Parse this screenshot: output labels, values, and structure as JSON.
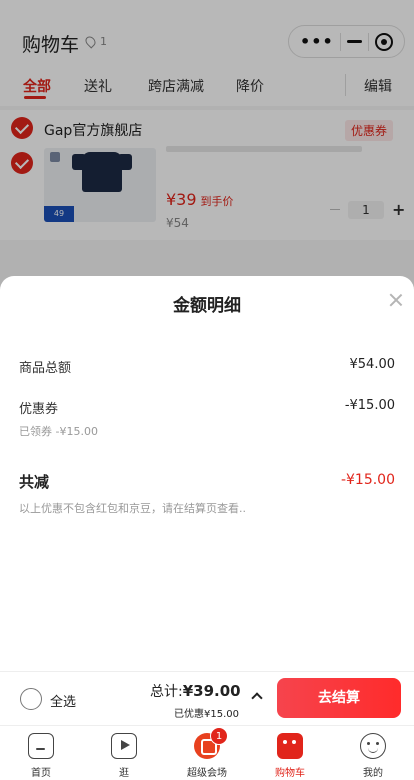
{
  "header": {
    "title": "购物车",
    "location_count": "1",
    "capsule": {
      "more_label": "•••",
      "minimize_icon": "minus-icon",
      "close_icon": "target-icon"
    }
  },
  "tabs": [
    {
      "label": "全部",
      "active": true
    },
    {
      "label": "送礼",
      "active": false
    },
    {
      "label": "跨店满减",
      "active": false
    },
    {
      "label": "降价",
      "active": false
    }
  ],
  "edit_label": "编辑",
  "store": {
    "name": "Gap官方旗舰店",
    "coupon_tag": "优惠券",
    "product": {
      "price": "¥39",
      "price_note": "到手价",
      "original_price": "¥54",
      "quantity": "1",
      "img_badge": "49"
    }
  },
  "sheet": {
    "title": "金额明细",
    "goods_total_label": "商品总额",
    "goods_total_value": "¥54.00",
    "coupon_label": "优惠券",
    "coupon_value": "-¥15.00",
    "coupon_sub": "已领券 -¥15.00",
    "total_reduction_label": "共减",
    "total_reduction_value": "-¥15.00",
    "note": "以上优惠不包含红包和京豆，请在结算页查看.."
  },
  "checkout": {
    "select_all": "全选",
    "sum_label": "总计:",
    "sum_value": "¥39.00",
    "saved": "已优惠¥15.00",
    "pay_label": "去结算"
  },
  "tabbar": [
    {
      "label": "首页",
      "icon": "home-icon"
    },
    {
      "label": "逛",
      "icon": "video-icon"
    },
    {
      "label": "超级会场",
      "icon": "venue-icon",
      "badge": "1"
    },
    {
      "label": "购物车",
      "icon": "cart-icon",
      "active": true
    },
    {
      "label": "我的",
      "icon": "profile-icon"
    }
  ],
  "colors": {
    "accent": "#e1251b",
    "overlay": "rgba(0,0,0,0.28)"
  }
}
